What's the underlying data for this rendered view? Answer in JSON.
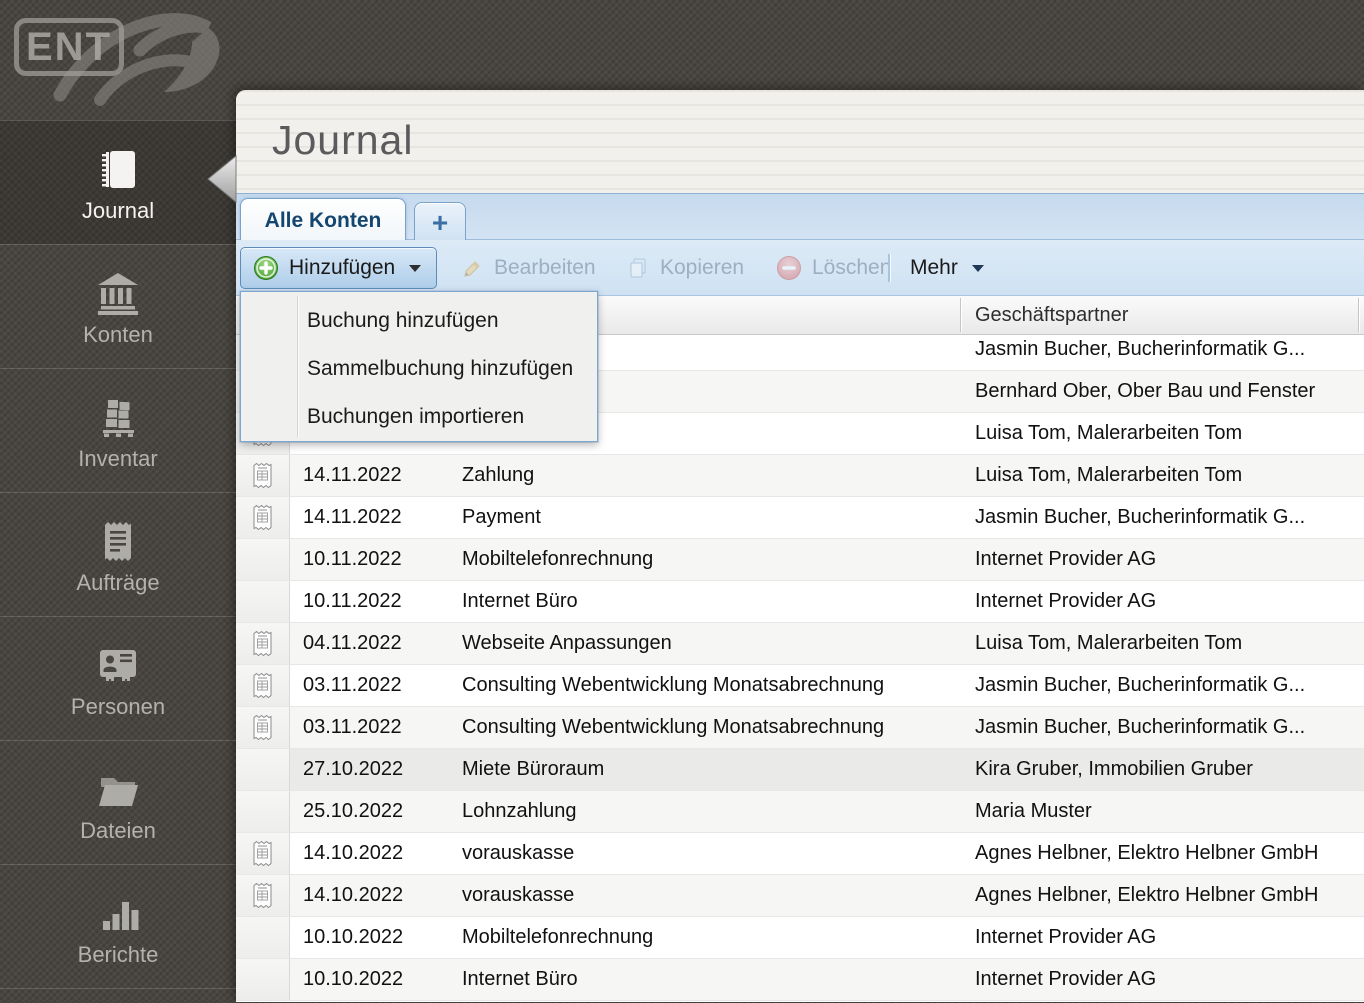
{
  "logo": {
    "text": "ENT"
  },
  "window": {
    "title": "Journal"
  },
  "sidebar": {
    "items": [
      {
        "label": "Journal",
        "icon": "notebook-icon",
        "active": true
      },
      {
        "label": "Konten",
        "icon": "bank-icon",
        "active": false
      },
      {
        "label": "Inventar",
        "icon": "pallet-icon",
        "active": false
      },
      {
        "label": "Aufträge",
        "icon": "receipt-doc-icon",
        "active": false
      },
      {
        "label": "Personen",
        "icon": "contact-card-icon",
        "active": false
      },
      {
        "label": "Dateien",
        "icon": "folder-icon",
        "active": false
      },
      {
        "label": "Berichte",
        "icon": "bar-chart-icon",
        "active": false
      }
    ]
  },
  "tabs": {
    "active_label": "Alle Konten",
    "add_label": "+"
  },
  "toolbar": {
    "add_label": "Hinzufügen",
    "edit_label": "Bearbeiten",
    "copy_label": "Kopieren",
    "delete_label": "Löschen",
    "more_label": "Mehr"
  },
  "add_menu": {
    "items": [
      {
        "label": "Buchung hinzufügen"
      },
      {
        "label": "Sammelbuchung hinzufügen"
      },
      {
        "label": "Buchungen importieren"
      }
    ]
  },
  "table": {
    "partner_column_label": "Geschäftspartner",
    "rows": [
      {
        "date": "",
        "text": "",
        "partner": "Jasmin Bucher, Bucherinformatik G...",
        "receipt": false,
        "highlighted": false,
        "clipped": true
      },
      {
        "date": "",
        "text": "",
        "partner": "Bernhard Ober, Ober Bau und Fenster",
        "receipt": false,
        "highlighted": false,
        "clipped": false
      },
      {
        "date": "",
        "text": "",
        "partner": "Luisa Tom, Malerarbeiten Tom",
        "receipt": true,
        "highlighted": false,
        "clipped": false
      },
      {
        "date": "14.11.2022",
        "text": "Zahlung",
        "partner": "Luisa Tom, Malerarbeiten Tom",
        "receipt": true,
        "highlighted": false,
        "clipped": false
      },
      {
        "date": "14.11.2022",
        "text": "Payment",
        "partner": "Jasmin Bucher, Bucherinformatik G...",
        "receipt": true,
        "highlighted": false,
        "clipped": false
      },
      {
        "date": "10.11.2022",
        "text": "Mobiltelefonrechnung",
        "partner": "Internet Provider AG",
        "receipt": false,
        "highlighted": false,
        "clipped": false
      },
      {
        "date": "10.11.2022",
        "text": "Internet Büro",
        "partner": "Internet Provider AG",
        "receipt": false,
        "highlighted": false,
        "clipped": false
      },
      {
        "date": "04.11.2022",
        "text": "Webseite Anpassungen",
        "partner": "Luisa Tom, Malerarbeiten Tom",
        "receipt": true,
        "highlighted": false,
        "clipped": false
      },
      {
        "date": "03.11.2022",
        "text": "Consulting Webentwicklung Monatsabrechnung",
        "partner": "Jasmin Bucher, Bucherinformatik G...",
        "receipt": true,
        "highlighted": false,
        "clipped": false
      },
      {
        "date": "03.11.2022",
        "text": "Consulting Webentwicklung Monatsabrechnung",
        "partner": "Jasmin Bucher, Bucherinformatik G...",
        "receipt": true,
        "highlighted": false,
        "clipped": false
      },
      {
        "date": "27.10.2022",
        "text": "Miete Büroraum",
        "partner": "Kira Gruber, Immobilien Gruber",
        "receipt": false,
        "highlighted": true,
        "clipped": false
      },
      {
        "date": "25.10.2022",
        "text": "Lohnzahlung",
        "partner": "Maria Muster",
        "receipt": false,
        "highlighted": false,
        "clipped": false
      },
      {
        "date": "14.10.2022",
        "text": "vorauskasse",
        "partner": "Agnes Helbner, Elektro Helbner GmbH",
        "receipt": true,
        "highlighted": false,
        "clipped": false
      },
      {
        "date": "14.10.2022",
        "text": "vorauskasse",
        "partner": "Agnes Helbner, Elektro Helbner GmbH",
        "receipt": true,
        "highlighted": false,
        "clipped": false
      },
      {
        "date": "10.10.2022",
        "text": "Mobiltelefonrechnung",
        "partner": "Internet Provider AG",
        "receipt": false,
        "highlighted": false,
        "clipped": false
      },
      {
        "date": "10.10.2022",
        "text": "Internet Büro",
        "partner": "Internet Provider AG",
        "receipt": false,
        "highlighted": false,
        "clipped": false
      }
    ]
  },
  "colors": {
    "accent_blue": "#3a6ea5",
    "tab_text_blue": "#14466f",
    "add_green": "#46a02e",
    "delete_red": "#d96b6b",
    "sidebar_dark": "#494540"
  }
}
